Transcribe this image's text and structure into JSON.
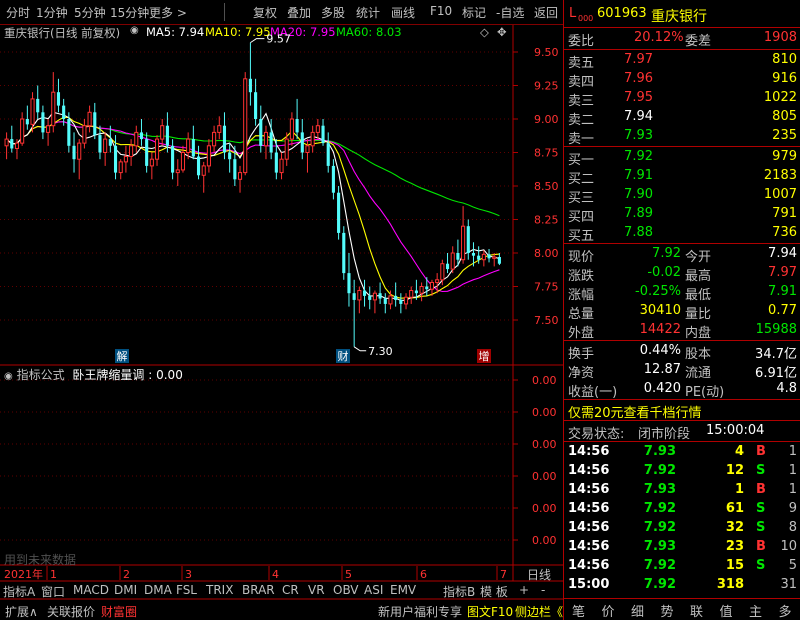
{
  "toolbar": {
    "items": [
      "分时",
      "1分钟",
      "5分钟",
      "15分钟",
      "更多 >",
      "复权",
      "叠加",
      "多股",
      "统计",
      "画线",
      "F10",
      "标记",
      "-自选",
      "返回"
    ]
  },
  "chart_info": {
    "stock": "重庆银行(日线 前复权)",
    "ma5": "MA5: 7.94",
    "ma10": "MA10: 7.95",
    "ma20": "MA20: 7.95",
    "ma60": "MA60: 8.03"
  },
  "chart_data": {
    "type": "candlestick",
    "y_ticks": [
      "9.50",
      "9.25",
      "9.00",
      "8.75",
      "8.50",
      "8.25",
      "8.00",
      "7.75",
      "7.50"
    ],
    "ylim": [
      7.35,
      9.65
    ],
    "high_label": "9.57",
    "low_label": "7.30",
    "markers": [
      "解",
      "财",
      "增"
    ],
    "x_ticks": [
      "2021年",
      "1",
      "2",
      "3",
      "4",
      "5",
      "6",
      "7"
    ],
    "ohlc": [
      [
        8.8,
        8.9,
        8.7,
        8.85
      ],
      [
        8.85,
        8.95,
        8.75,
        8.78
      ],
      [
        8.78,
        8.85,
        8.7,
        8.82
      ],
      [
        8.82,
        9.05,
        8.8,
        9.0
      ],
      [
        9.0,
        9.1,
        8.92,
        8.96
      ],
      [
        8.96,
        9.2,
        8.9,
        9.15
      ],
      [
        9.15,
        9.25,
        9.0,
        9.05
      ],
      [
        9.05,
        9.1,
        8.85,
        8.9
      ],
      [
        8.9,
        9.0,
        8.8,
        8.95
      ],
      [
        8.95,
        9.35,
        8.9,
        9.2
      ],
      [
        9.2,
        9.3,
        9.05,
        9.1
      ],
      [
        9.1,
        9.15,
        8.95,
        9.0
      ],
      [
        9.0,
        9.05,
        8.75,
        8.8
      ],
      [
        8.8,
        8.9,
        8.6,
        8.7
      ],
      [
        8.7,
        8.85,
        8.55,
        8.82
      ],
      [
        8.82,
        9.0,
        8.78,
        8.95
      ],
      [
        8.95,
        9.1,
        8.9,
        9.05
      ],
      [
        9.05,
        9.12,
        8.85,
        8.88
      ],
      [
        8.88,
        8.95,
        8.7,
        8.75
      ],
      [
        8.75,
        8.9,
        8.65,
        8.85
      ],
      [
        8.85,
        8.95,
        8.75,
        8.8
      ],
      [
        8.8,
        8.88,
        8.55,
        8.6
      ],
      [
        8.6,
        8.7,
        8.55,
        8.68
      ],
      [
        8.68,
        8.8,
        8.6,
        8.72
      ],
      [
        8.72,
        8.85,
        8.65,
        8.8
      ],
      [
        8.8,
        8.95,
        8.75,
        8.9
      ],
      [
        8.9,
        9.0,
        8.8,
        8.85
      ],
      [
        8.85,
        8.9,
        8.6,
        8.65
      ],
      [
        8.65,
        8.75,
        8.55,
        8.7
      ],
      [
        8.7,
        8.88,
        8.65,
        8.85
      ],
      [
        8.85,
        9.0,
        8.8,
        8.95
      ],
      [
        8.95,
        9.05,
        8.75,
        8.8
      ],
      [
        8.8,
        8.85,
        8.55,
        8.6
      ],
      [
        8.6,
        8.7,
        8.5,
        8.62
      ],
      [
        8.62,
        8.8,
        8.6,
        8.75
      ],
      [
        8.75,
        8.9,
        8.7,
        8.85
      ],
      [
        8.85,
        8.95,
        8.7,
        8.72
      ],
      [
        8.72,
        8.8,
        8.55,
        8.58
      ],
      [
        8.58,
        8.68,
        8.45,
        8.65
      ],
      [
        8.65,
        8.85,
        8.6,
        8.8
      ],
      [
        8.8,
        8.95,
        8.75,
        8.9
      ],
      [
        8.9,
        9.02,
        8.85,
        8.95
      ],
      [
        8.95,
        9.05,
        8.7,
        8.75
      ],
      [
        8.75,
        8.82,
        8.6,
        8.7
      ],
      [
        8.7,
        8.8,
        8.5,
        8.55
      ],
      [
        8.55,
        8.65,
        8.45,
        8.6
      ],
      [
        8.6,
        9.35,
        8.58,
        9.3
      ],
      [
        9.3,
        9.57,
        9.1,
        9.2
      ],
      [
        9.2,
        9.3,
        8.95,
        9.0
      ],
      [
        9.0,
        9.1,
        8.75,
        8.8
      ],
      [
        8.8,
        8.95,
        8.7,
        8.9
      ],
      [
        8.9,
        9.0,
        8.7,
        8.75
      ],
      [
        8.75,
        8.85,
        8.55,
        8.6
      ],
      [
        8.6,
        8.75,
        8.55,
        8.7
      ],
      [
        8.7,
        8.9,
        8.65,
        8.85
      ],
      [
        8.85,
        9.05,
        8.8,
        9.0
      ],
      [
        9.0,
        9.15,
        8.85,
        8.9
      ],
      [
        8.9,
        9.0,
        8.7,
        8.75
      ],
      [
        8.75,
        8.85,
        8.6,
        8.8
      ],
      [
        8.8,
        8.95,
        8.75,
        8.9
      ],
      [
        8.9,
        9.0,
        8.85,
        8.95
      ],
      [
        8.95,
        9.0,
        8.8,
        8.82
      ],
      [
        8.82,
        8.9,
        8.6,
        8.65
      ],
      [
        8.65,
        8.7,
        8.4,
        8.45
      ],
      [
        8.45,
        8.5,
        8.1,
        8.15
      ],
      [
        8.15,
        8.2,
        7.8,
        7.85
      ],
      [
        7.85,
        8.0,
        7.6,
        7.7
      ],
      [
        7.7,
        7.8,
        7.3,
        7.65
      ],
      [
        7.65,
        7.75,
        7.55,
        7.72
      ],
      [
        7.72,
        7.8,
        7.6,
        7.68
      ],
      [
        7.68,
        7.75,
        7.58,
        7.65
      ],
      [
        7.65,
        7.72,
        7.55,
        7.7
      ],
      [
        7.7,
        7.78,
        7.62,
        7.66
      ],
      [
        7.66,
        7.7,
        7.55,
        7.62
      ],
      [
        7.62,
        7.72,
        7.58,
        7.68
      ],
      [
        7.68,
        7.78,
        7.6,
        7.65
      ],
      [
        7.65,
        7.7,
        7.55,
        7.62
      ],
      [
        7.62,
        7.7,
        7.58,
        7.67
      ],
      [
        7.67,
        7.75,
        7.62,
        7.72
      ],
      [
        7.72,
        7.8,
        7.65,
        7.7
      ],
      [
        7.7,
        7.78,
        7.64,
        7.75
      ],
      [
        7.75,
        7.82,
        7.68,
        7.73
      ],
      [
        7.73,
        7.8,
        7.68,
        7.78
      ],
      [
        7.78,
        7.85,
        7.7,
        7.8
      ],
      [
        7.8,
        7.95,
        7.76,
        7.92
      ],
      [
        7.92,
        8.0,
        7.85,
        7.88
      ],
      [
        7.88,
        8.05,
        7.85,
        8.0
      ],
      [
        8.0,
        8.1,
        7.9,
        7.95
      ],
      [
        7.95,
        8.35,
        7.92,
        8.2
      ],
      [
        8.2,
        8.25,
        7.95,
        8.0
      ],
      [
        8.0,
        8.08,
        7.9,
        7.98
      ],
      [
        7.98,
        8.05,
        7.92,
        7.95
      ],
      [
        7.95,
        8.02,
        7.9,
        7.99
      ],
      [
        7.99,
        8.03,
        7.93,
        7.96
      ],
      [
        7.96,
        8.0,
        7.9,
        7.97
      ],
      [
        7.97,
        8.0,
        7.91,
        7.92
      ]
    ]
  },
  "indicator": {
    "title": "指标公式",
    "name": "卧王牌缩量调",
    "value": "0.00",
    "y_ticks": [
      "0.00",
      "0.00",
      "0.00",
      "0.00",
      "0.00",
      "0.00"
    ],
    "watermark": "用到未来数据"
  },
  "tabs1": [
    "指标A",
    "窗口",
    "MACD",
    "DMI",
    "DMA",
    "FSL",
    "TRIX",
    "BRAR",
    "CR",
    "VR",
    "OBV",
    "ASI",
    "EMV",
    "指标B",
    "模 板",
    "+",
    "-",
    "日线"
  ],
  "tabs2": {
    "left": [
      "扩展∧",
      "关联报价",
      "财富圈"
    ],
    "right": [
      "新用户福利专享",
      "图文F10",
      "侧边栏《"
    ]
  },
  "quote": {
    "badge": "L",
    "badge_sub": "000",
    "code": "601963",
    "name": "重庆银行",
    "weibi_label": "委比",
    "weibi": "20.12%",
    "weicha_label": "委差",
    "weicha": "1908",
    "asks": [
      {
        "label": "卖五",
        "price": "7.97",
        "vol": "810"
      },
      {
        "label": "卖四",
        "price": "7.96",
        "vol": "916"
      },
      {
        "label": "卖三",
        "price": "7.95",
        "vol": "1022"
      },
      {
        "label": "卖二",
        "price": "7.94",
        "vol": "805"
      },
      {
        "label": "卖一",
        "price": "7.93",
        "vol": "235"
      }
    ],
    "bids": [
      {
        "label": "买一",
        "price": "7.92",
        "vol": "979"
      },
      {
        "label": "买二",
        "price": "7.91",
        "vol": "2183"
      },
      {
        "label": "买三",
        "price": "7.90",
        "vol": "1007"
      },
      {
        "label": "买四",
        "price": "7.89",
        "vol": "791"
      },
      {
        "label": "买五",
        "price": "7.88",
        "vol": "736"
      }
    ],
    "stats1": [
      {
        "l1": "现价",
        "v1": "7.92",
        "l2": "今开",
        "v2": "7.94"
      },
      {
        "l1": "涨跌",
        "v1": "-0.02",
        "l2": "最高",
        "v2": "7.97"
      },
      {
        "l1": "涨幅",
        "v1": "-0.25%",
        "l2": "最低",
        "v2": "7.91"
      },
      {
        "l1": "总量",
        "v1": "30410",
        "l2": "量比",
        "v2": "0.77"
      },
      {
        "l1": "外盘",
        "v1": "14422",
        "l2": "内盘",
        "v2": "15988"
      }
    ],
    "stats2": [
      {
        "l1": "换手",
        "v1": "0.44%",
        "l2": "股本",
        "v2": "34.7亿"
      },
      {
        "l1": "净资",
        "v1": "12.87",
        "l2": "流通",
        "v2": "6.91亿"
      },
      {
        "l1": "收益(一)",
        "v1": "0.420",
        "l2": "PE(动)",
        "v2": "4.8"
      }
    ],
    "promo": "仅需20元查看千档行情",
    "trade_status_label": "交易状态:",
    "trade_status": "闭市阶段",
    "trade_time": "15:00:04",
    "ticks": [
      {
        "t": "14:56",
        "p": "7.93",
        "v": "4",
        "bs": "B",
        "n": "1"
      },
      {
        "t": "14:56",
        "p": "7.92",
        "v": "12",
        "bs": "S",
        "n": "1"
      },
      {
        "t": "14:56",
        "p": "7.93",
        "v": "1",
        "bs": "B",
        "n": "1"
      },
      {
        "t": "14:56",
        "p": "7.92",
        "v": "61",
        "bs": "S",
        "n": "9"
      },
      {
        "t": "14:56",
        "p": "7.92",
        "v": "32",
        "bs": "S",
        "n": "8"
      },
      {
        "t": "14:56",
        "p": "7.93",
        "v": "23",
        "bs": "B",
        "n": "10"
      },
      {
        "t": "14:56",
        "p": "7.92",
        "v": "15",
        "bs": "S",
        "n": "5"
      },
      {
        "t": "15:00",
        "p": "7.92",
        "v": "318",
        "bs": "",
        "n": "31"
      }
    ],
    "side_tabs": [
      "笔",
      "价",
      "细",
      "势",
      "联",
      "值",
      "主",
      "多"
    ]
  }
}
